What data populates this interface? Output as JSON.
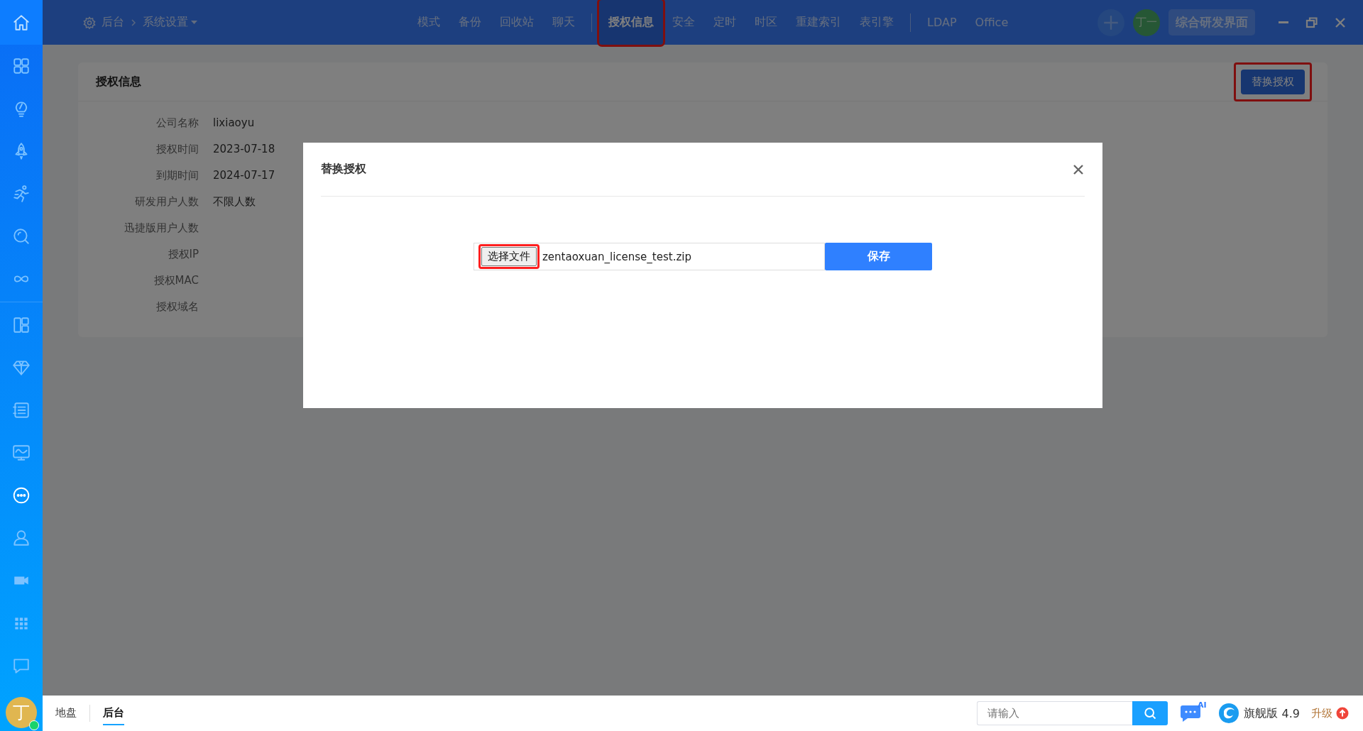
{
  "sidebar": {
    "items": [
      {
        "kind": "home",
        "selected": false
      },
      {
        "kind": "grid",
        "selected": false
      },
      {
        "kind": "bulb",
        "selected": false
      },
      {
        "kind": "rocket",
        "selected": false
      },
      {
        "kind": "runner",
        "selected": false
      },
      {
        "kind": "search",
        "selected": false
      },
      {
        "kind": "infinity",
        "selected": false
      },
      {
        "kind": "divider"
      },
      {
        "kind": "layout",
        "selected": false
      },
      {
        "kind": "diamond",
        "selected": false
      },
      {
        "kind": "list",
        "selected": false
      },
      {
        "kind": "monitor",
        "selected": false
      },
      {
        "kind": "more",
        "selected": true
      },
      {
        "kind": "user",
        "selected": false
      },
      {
        "kind": "video",
        "selected": false
      },
      {
        "kind": "apps",
        "selected": false
      },
      {
        "kind": "chat",
        "selected": false
      }
    ],
    "avatar": {
      "initial": "丁",
      "online": true
    }
  },
  "top_bar": {
    "breadcrumb": [
      {
        "label": "后台"
      },
      {
        "label": "系统设置"
      }
    ],
    "nav": [
      {
        "kind": "tab",
        "label": "模式",
        "selected": false,
        "highlighted": false
      },
      {
        "kind": "tab",
        "label": "备份",
        "selected": false,
        "highlighted": false
      },
      {
        "kind": "tab",
        "label": "回收站",
        "selected": false,
        "highlighted": false
      },
      {
        "kind": "tab",
        "label": "聊天",
        "selected": false,
        "highlighted": false
      },
      {
        "kind": "separator"
      },
      {
        "kind": "tab",
        "label": "授权信息",
        "selected": true,
        "highlighted": true
      },
      {
        "kind": "tab",
        "label": "安全",
        "selected": false,
        "highlighted": false
      },
      {
        "kind": "tab",
        "label": "定时",
        "selected": false,
        "highlighted": false
      },
      {
        "kind": "tab",
        "label": "时区",
        "selected": false,
        "highlighted": false
      },
      {
        "kind": "tab",
        "label": "重建索引",
        "selected": false,
        "highlighted": false
      },
      {
        "kind": "tab",
        "label": "表引擎",
        "selected": false,
        "highlighted": false
      },
      {
        "kind": "separator"
      },
      {
        "kind": "tab",
        "label": "LDAP",
        "selected": false,
        "highlighted": false
      },
      {
        "kind": "tab",
        "label": "Office",
        "selected": false,
        "highlighted": false
      }
    ],
    "user_avatar": "丁一",
    "mode_button": "综合研发界面"
  },
  "license_card": {
    "title": "授权信息",
    "replace_button": {
      "label": "替换授权",
      "highlighted": true
    },
    "rows": [
      {
        "label": "公司名称",
        "value": "lixiaoyu"
      },
      {
        "label": "授权时间",
        "value": "2023-07-18"
      },
      {
        "label": "到期时间",
        "value": "2024-07-17"
      },
      {
        "label": "研发用户人数",
        "value": "不限人数"
      },
      {
        "label": "迅捷版用户人数"
      },
      {
        "label": "授权IP"
      },
      {
        "label": "授权MAC"
      },
      {
        "label": "授权域名"
      }
    ]
  },
  "dialog": {
    "title": "替换授权",
    "file_button": {
      "label": "选择文件",
      "highlighted": true
    },
    "file_name": "zentaoxuan_license_test.zip",
    "save_button": "保存"
  },
  "bottom_bar": {
    "tabs": [
      {
        "label": "地盘",
        "selected": false
      },
      {
        "label": "后台",
        "selected": true
      }
    ],
    "search": {
      "placeholder": "请输入"
    },
    "ai_badge": "AI",
    "edition": "旗舰版",
    "version": "4.9",
    "upgrade": "升级"
  }
}
